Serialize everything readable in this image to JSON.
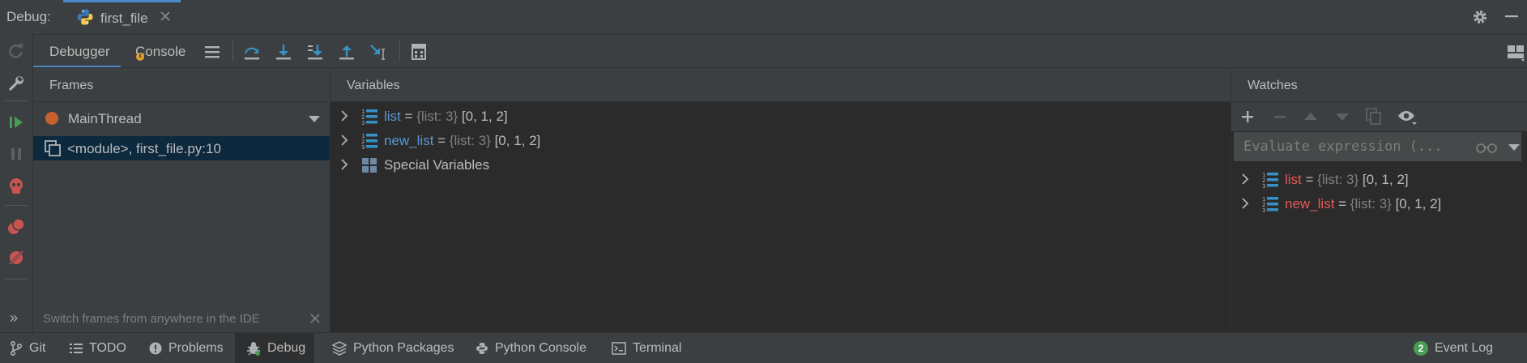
{
  "titlebar": {
    "label": "Debug:",
    "run_tab": "first_file"
  },
  "toolbar": {
    "tab_debugger": "Debugger",
    "tab_console": "Console"
  },
  "frames": {
    "header": "Frames",
    "thread": "MainThread",
    "frame_item": "<module>, first_file.py:10",
    "hint": "Switch frames from anywhere in the IDE with ..."
  },
  "variables": {
    "header": "Variables",
    "items": [
      {
        "name": "list",
        "eq": " = ",
        "type": "{list: 3}",
        "value": " [0, 1, 2]"
      },
      {
        "name": "new_list",
        "eq": " = ",
        "type": "{list: 3}",
        "value": " [0, 1, 2]"
      },
      {
        "name": "Special Variables"
      }
    ]
  },
  "watches": {
    "header": "Watches",
    "eval_placeholder": "Evaluate expression (...",
    "items": [
      {
        "name": "list",
        "eq": " = ",
        "type": "{list: 3}",
        "value": " [0, 1, 2]"
      },
      {
        "name": "new_list",
        "eq": " = ",
        "type": "{list: 3}",
        "value": " [0, 1, 2]"
      }
    ]
  },
  "bottom": {
    "git": "Git",
    "todo": "TODO",
    "problems": "Problems",
    "debug": "Debug",
    "python_packages": "Python Packages",
    "python_console": "Python Console",
    "terminal": "Terminal",
    "event_log": "Event Log",
    "event_count": "2"
  },
  "colors": {
    "accent": "#4a88c7",
    "run_green": "#499c54",
    "stop_red": "#c75450",
    "var_blue": "#5896d6",
    "watch_red": "#e45a5a",
    "breakpoint_orange": "#c9602f"
  }
}
